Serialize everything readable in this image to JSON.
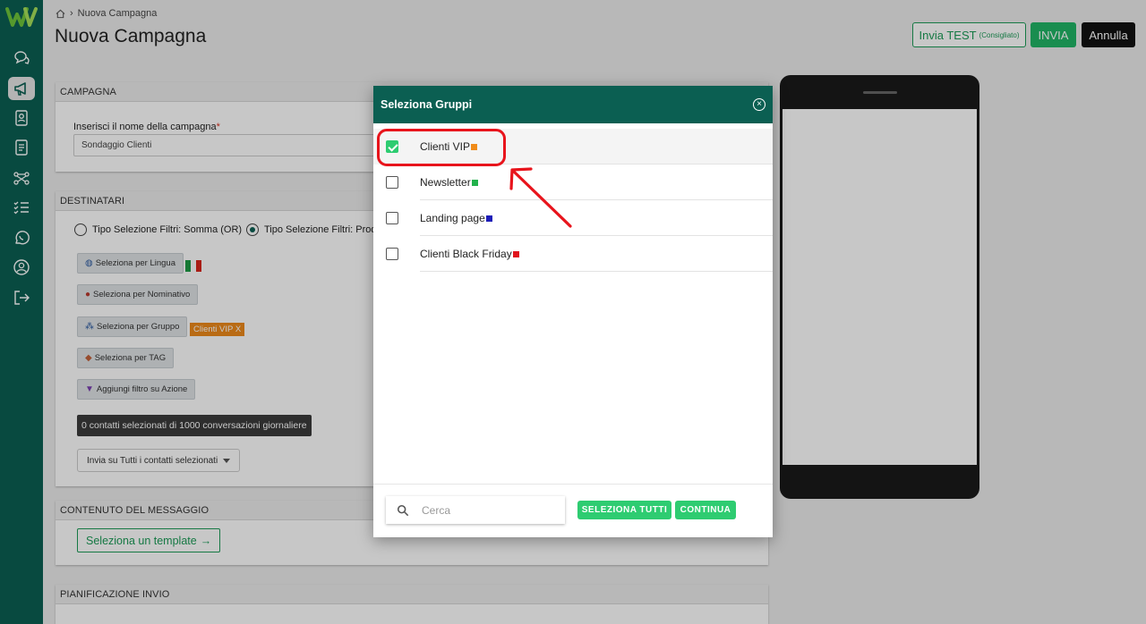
{
  "app": {
    "breadcrumb_current": "Nuova Campagna",
    "page_title": "Nuova Campagna"
  },
  "header": {
    "test_label": "Invia TEST",
    "test_hint": "(Consigliato)",
    "send_label": "INVIA",
    "cancel_label": "Annulla"
  },
  "sidebar": {
    "items": [
      {
        "icon": "chat-icon"
      },
      {
        "icon": "megaphone-icon",
        "active": true
      },
      {
        "icon": "contacts-icon"
      },
      {
        "icon": "document-icon"
      },
      {
        "icon": "flow-icon"
      },
      {
        "icon": "checklist-icon"
      },
      {
        "icon": "whatsapp-icon"
      },
      {
        "icon": "user-icon"
      },
      {
        "icon": "logout-icon"
      }
    ]
  },
  "campagna": {
    "header": "CAMPAGNA",
    "name_label": "Inserisci il nome della campagna",
    "required_mark": "*",
    "name_value": "Sondaggio Clienti"
  },
  "destinatari": {
    "header": "DESTINATARI",
    "radio_or": "Tipo Selezione Filtri: Somma (OR)",
    "radio_and": "Tipo Selezione Filtri: Prodo",
    "btn_lingua": "Seleziona per Lingua",
    "btn_nominativo": "Seleziona per Nominativo",
    "btn_gruppo": "Seleziona per Gruppo",
    "tag_selected": "Clienti VIP X",
    "btn_tag": "Seleziona per TAG",
    "btn_azione": "Aggiungi filtro su Azione",
    "count_text": "0 contatti selezionati di 1000 conversazioni giornaliere",
    "send_mode": "Invia su Tutti i contatti selezionati"
  },
  "contenuto": {
    "header": "CONTENUTO DEL MESSAGGIO",
    "template_btn": "Seleziona un template"
  },
  "pianificazione": {
    "header": "PIANIFICAZIONE INVIO"
  },
  "modal": {
    "title": "Seleziona Gruppi",
    "groups": [
      {
        "label": "Clienti VIP",
        "color": "#f08c1a",
        "checked": true
      },
      {
        "label": "Newsletter",
        "color": "#22b14c",
        "checked": false
      },
      {
        "label": "Landing page",
        "color": "#1d1db8",
        "checked": false
      },
      {
        "label": "Clienti Black Friday",
        "color": "#e0141c",
        "checked": false
      }
    ],
    "search_placeholder": "Cerca",
    "select_all_label": "SELEZIONA TUTTI",
    "continue_label": "CONTINUA"
  },
  "colors": {
    "brand_dark": "#0b5f52",
    "accent_green": "#2ecc71",
    "annotation_red": "#e8141c",
    "tag_orange": "#ee8a1a"
  }
}
